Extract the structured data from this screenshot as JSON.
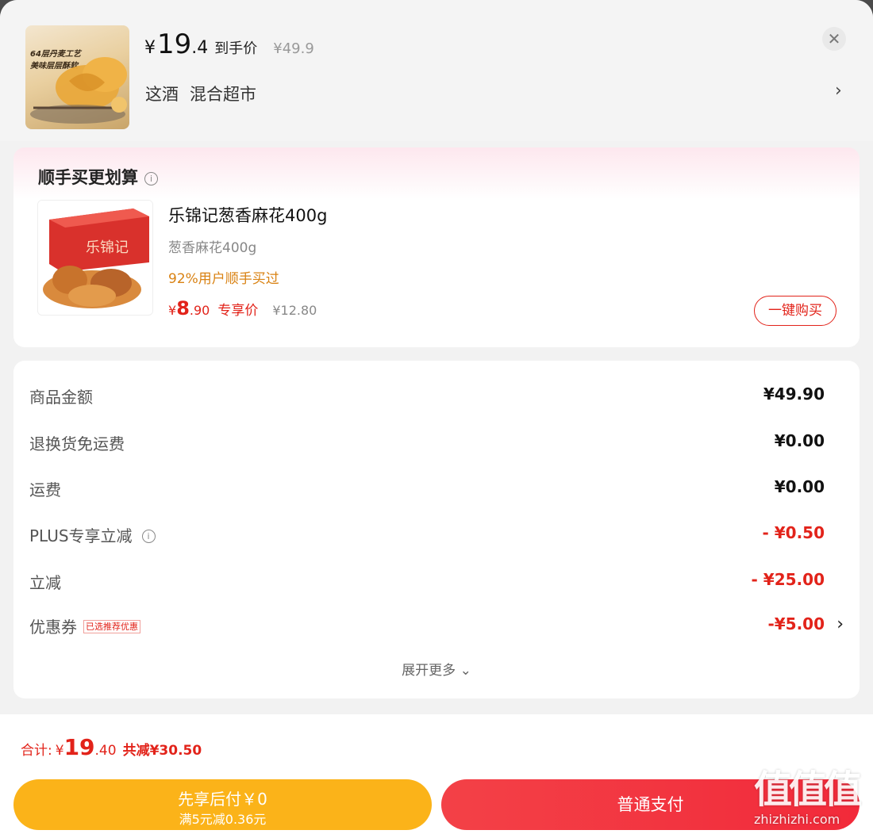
{
  "header": {
    "product_image_text_1": "64层丹麦工艺",
    "product_image_text_2": "美味层层酥软",
    "price_symbol": "¥",
    "price_int": "19",
    "price_dec": ".4",
    "price_label": "到手价",
    "original_price": "¥49.9",
    "store_name": "这酒",
    "store_type": "混合超市",
    "close_icon": "close-icon",
    "chevron_icon": "chevron-right-icon"
  },
  "addon": {
    "title": "顺手买更划算",
    "product_name": "乐锦记葱香麻花400g",
    "spec": "葱香麻花400g",
    "note": "92%用户顺手买过",
    "price_symbol": "¥",
    "price_int": "8",
    "price_dec": ".90",
    "price_label": "专享价",
    "original_price": "¥12.80",
    "buy_button": "一键购买",
    "box_brand_text": "乐锦记"
  },
  "summary": {
    "rows": [
      {
        "label": "商品金额",
        "value": "¥49.90"
      },
      {
        "label": "退换货免运费",
        "value": "¥0.00"
      },
      {
        "label": "运费",
        "value": "¥0.00"
      },
      {
        "label": "PLUS专享立减",
        "value": "- ¥0.50"
      },
      {
        "label": "立减",
        "value": "- ¥25.00"
      },
      {
        "label": "优惠券",
        "tag": "已选推荐优惠",
        "value": "-¥5.00"
      }
    ],
    "expand_label": "展开更多"
  },
  "bottom": {
    "total_label": "合计:",
    "total_symbol": "¥",
    "total_int": "19",
    "total_dec": ".40",
    "total_saved": "共减¥30.50",
    "paylater_line1": "先享后付￥0",
    "paylater_line2": "满5元减0.36元",
    "pay_button": "普通支付"
  },
  "watermark": {
    "logo": "值值值",
    "site": "zhizhizhi.com"
  },
  "colors": {
    "accent_red": "#e2231a",
    "promo_orange": "#d98213",
    "paylater_yellow": "#fbb319",
    "pay_red": "#f34147"
  }
}
